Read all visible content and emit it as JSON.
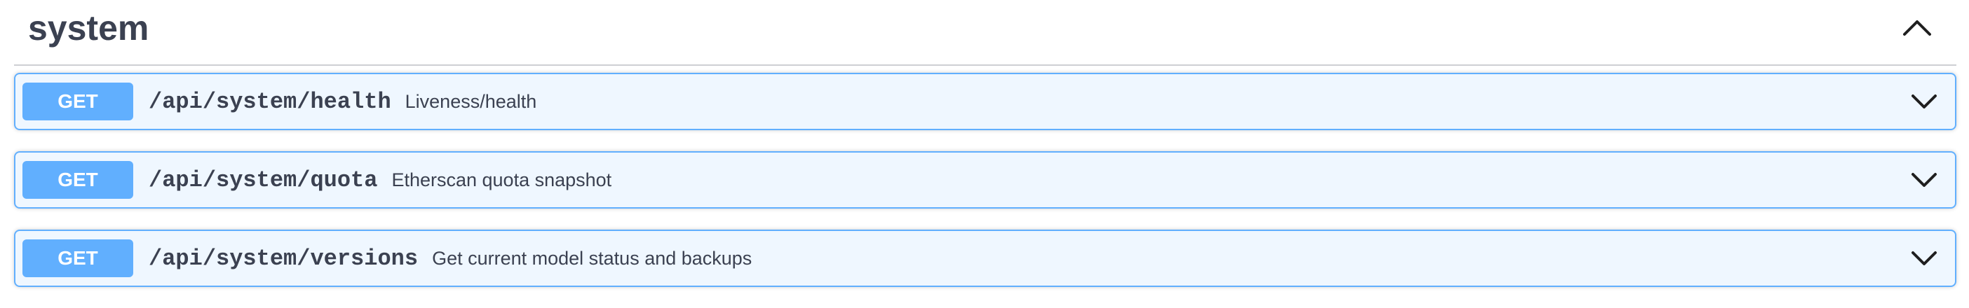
{
  "section": {
    "title": "system",
    "collapse_icon": "chevron-up-icon"
  },
  "operations": [
    {
      "method": "GET",
      "path": "/api/system/health",
      "summary": "Liveness/health",
      "expand_icon": "chevron-down-icon"
    },
    {
      "method": "GET",
      "path": "/api/system/quota",
      "summary": "Etherscan quota snapshot",
      "expand_icon": "chevron-down-icon"
    },
    {
      "method": "GET",
      "path": "/api/system/versions",
      "summary": "Get current model status and backups",
      "expand_icon": "chevron-down-icon"
    }
  ],
  "colors": {
    "get_accent": "#61affe",
    "get_background": "#eff6fe",
    "text": "#3b4151"
  }
}
